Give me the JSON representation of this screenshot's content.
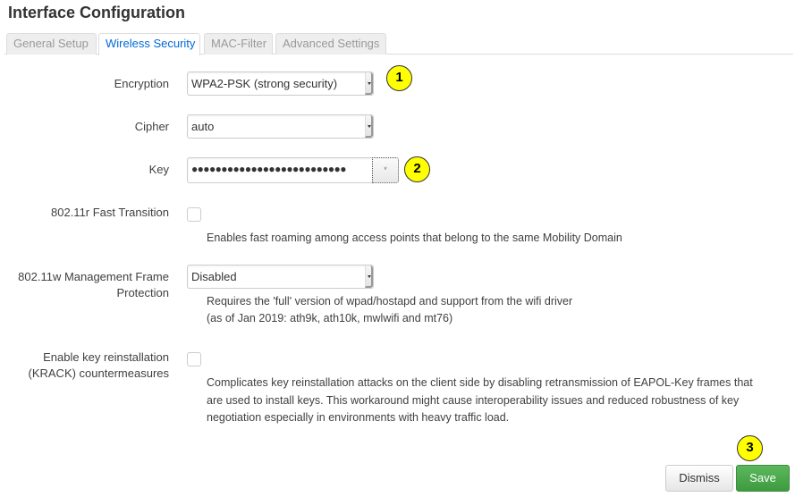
{
  "page": {
    "title": "Interface Configuration"
  },
  "tabs": [
    {
      "label": "General Setup",
      "active": false
    },
    {
      "label": "Wireless Security",
      "active": true
    },
    {
      "label": "MAC-Filter",
      "active": false
    },
    {
      "label": "Advanced Settings",
      "active": false
    }
  ],
  "form": {
    "encryption": {
      "label": "Encryption",
      "value": "WPA2-PSK (strong security)"
    },
    "cipher": {
      "label": "Cipher",
      "value": "auto"
    },
    "key": {
      "label": "Key",
      "masked_value": "●●●●●●●●●●●●●●●●●●●●●●●●●●",
      "reveal_glyph": "*"
    },
    "fast_transition": {
      "label": "802.11r Fast Transition",
      "checked": false,
      "description": "Enables fast roaming among access points that belong to the same Mobility Domain"
    },
    "mgmt_frame": {
      "label_line1": "802.11w Management Frame",
      "label_line2": "Protection",
      "value": "Disabled",
      "description_line1": "Requires the 'full' version of wpad/hostapd and support from the wifi driver",
      "description_line2": "(as of Jan 2019: ath9k, ath10k, mwlwifi and mt76)"
    },
    "krack": {
      "label_line1": "Enable key reinstallation",
      "label_line2": "(KRACK) countermeasures",
      "checked": false,
      "description_line1": "Complicates key reinstallation attacks on the client side by disabling retransmission of EAPOL-Key frames that",
      "description_line2": "are used to install keys. This workaround might cause interoperability issues and reduced robustness of key",
      "description_line3": "negotiation especially in environments with heavy traffic load."
    }
  },
  "annotations": [
    "1",
    "2",
    "3"
  ],
  "buttons": {
    "dismiss": "Dismiss",
    "save": "Save"
  },
  "colors": {
    "active_tab": "#0069d6",
    "save_button": "#4cae4c",
    "annotation": "#ffff00"
  }
}
